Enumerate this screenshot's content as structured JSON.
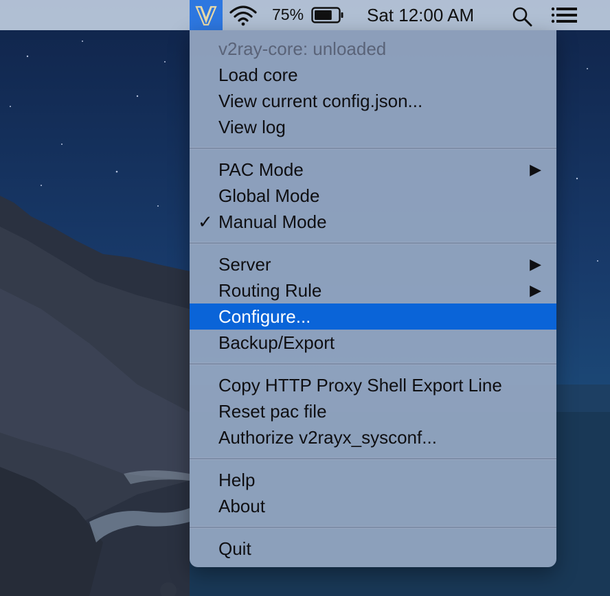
{
  "menubar": {
    "app_icon": "v2rayx-logo-icon",
    "wifi_icon": "wifi-icon",
    "battery_percent": "75%",
    "battery_level": 0.75,
    "battery_icon": "battery-icon",
    "clock": "Sat 12:00 AM",
    "search_icon": "search-icon",
    "control_icon": "control-center-icon",
    "highlight_color": "#2d77e0"
  },
  "menu": {
    "status": "v2ray-core: unloaded",
    "group1": [
      "Load core",
      "View current config.json...",
      "View log"
    ],
    "pac_mode": "PAC Mode",
    "global_mode": "Global Mode",
    "manual_mode": "Manual Mode",
    "manual_checked": true,
    "check_mark": "✓",
    "submenu_arrow": "▶",
    "server": "Server",
    "routing_rule": "Routing Rule",
    "configure": "Configure...",
    "backup_export": "Backup/Export",
    "copy_proxy": "Copy HTTP Proxy Shell Export Line",
    "reset_pac": "Reset pac file",
    "authorize": "Authorize v2rayx_sysconf...",
    "help": "Help",
    "about": "About",
    "quit": "Quit",
    "highlighted_item": "Configure...",
    "selection_color": "#0a64d8"
  }
}
